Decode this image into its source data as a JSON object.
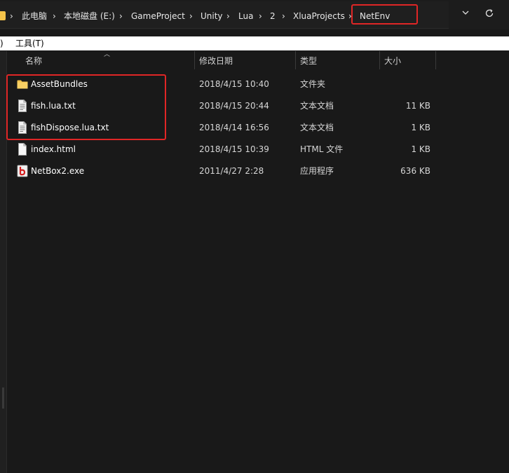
{
  "breadcrumb": {
    "items": [
      "此电脑",
      "本地磁盘 (E:)",
      "GameProject",
      "Unity",
      "Lua",
      "2",
      "XluaProjects",
      "NetEnv"
    ],
    "separator": "›"
  },
  "menubar": {
    "partial": ")",
    "tools": "工具(T)"
  },
  "columns": {
    "name": "名称",
    "date": "修改日期",
    "type": "类型",
    "size": "大小"
  },
  "files": [
    {
      "name": "AssetBundles",
      "date": "2018/4/15 10:40",
      "type": "文件夹",
      "size": "",
      "icon": "folder-icon"
    },
    {
      "name": "fish.lua.txt",
      "date": "2018/4/15 20:44",
      "type": "文本文档",
      "size": "11 KB",
      "icon": "text-file-icon"
    },
    {
      "name": "fishDispose.lua.txt",
      "date": "2018/4/14 16:56",
      "type": "文本文档",
      "size": "1 KB",
      "icon": "text-file-icon"
    },
    {
      "name": "index.html",
      "date": "2018/4/15 10:39",
      "type": "HTML 文件",
      "size": "1 KB",
      "icon": "html-file-icon"
    },
    {
      "name": "NetBox2.exe",
      "date": "2011/4/27 2:28",
      "type": "应用程序",
      "size": "636 KB",
      "icon": "exe-icon"
    }
  ],
  "colors": {
    "background": "#191919",
    "highlight": "#e02626",
    "folder": "#f4c34a"
  }
}
